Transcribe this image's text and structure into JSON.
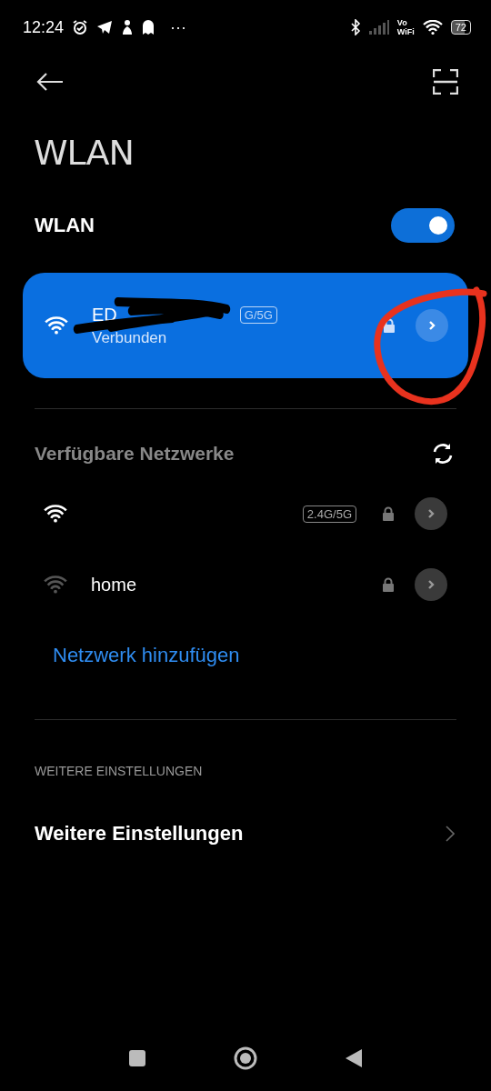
{
  "status_bar": {
    "time": "12:24",
    "more": "···",
    "vowifi_top": "Vo",
    "vowifi_bottom": "WiFi",
    "battery": "72"
  },
  "title": "WLAN",
  "wlan_toggle": {
    "label": "WLAN",
    "on": true
  },
  "connected": {
    "name": "ED",
    "band": "G/5G",
    "status": "Verbunden",
    "locked": true
  },
  "available": {
    "heading": "Verfügbare Netzwerke",
    "networks": [
      {
        "band": "2.4G/5G",
        "locked": true,
        "weak": false
      },
      {
        "name": "home",
        "locked": true,
        "weak": true
      }
    ]
  },
  "add_network": "Netzwerk hinzufügen",
  "more_section": {
    "caption": "WEITERE EINSTELLUNGEN",
    "item": "Weitere Einstellungen"
  }
}
